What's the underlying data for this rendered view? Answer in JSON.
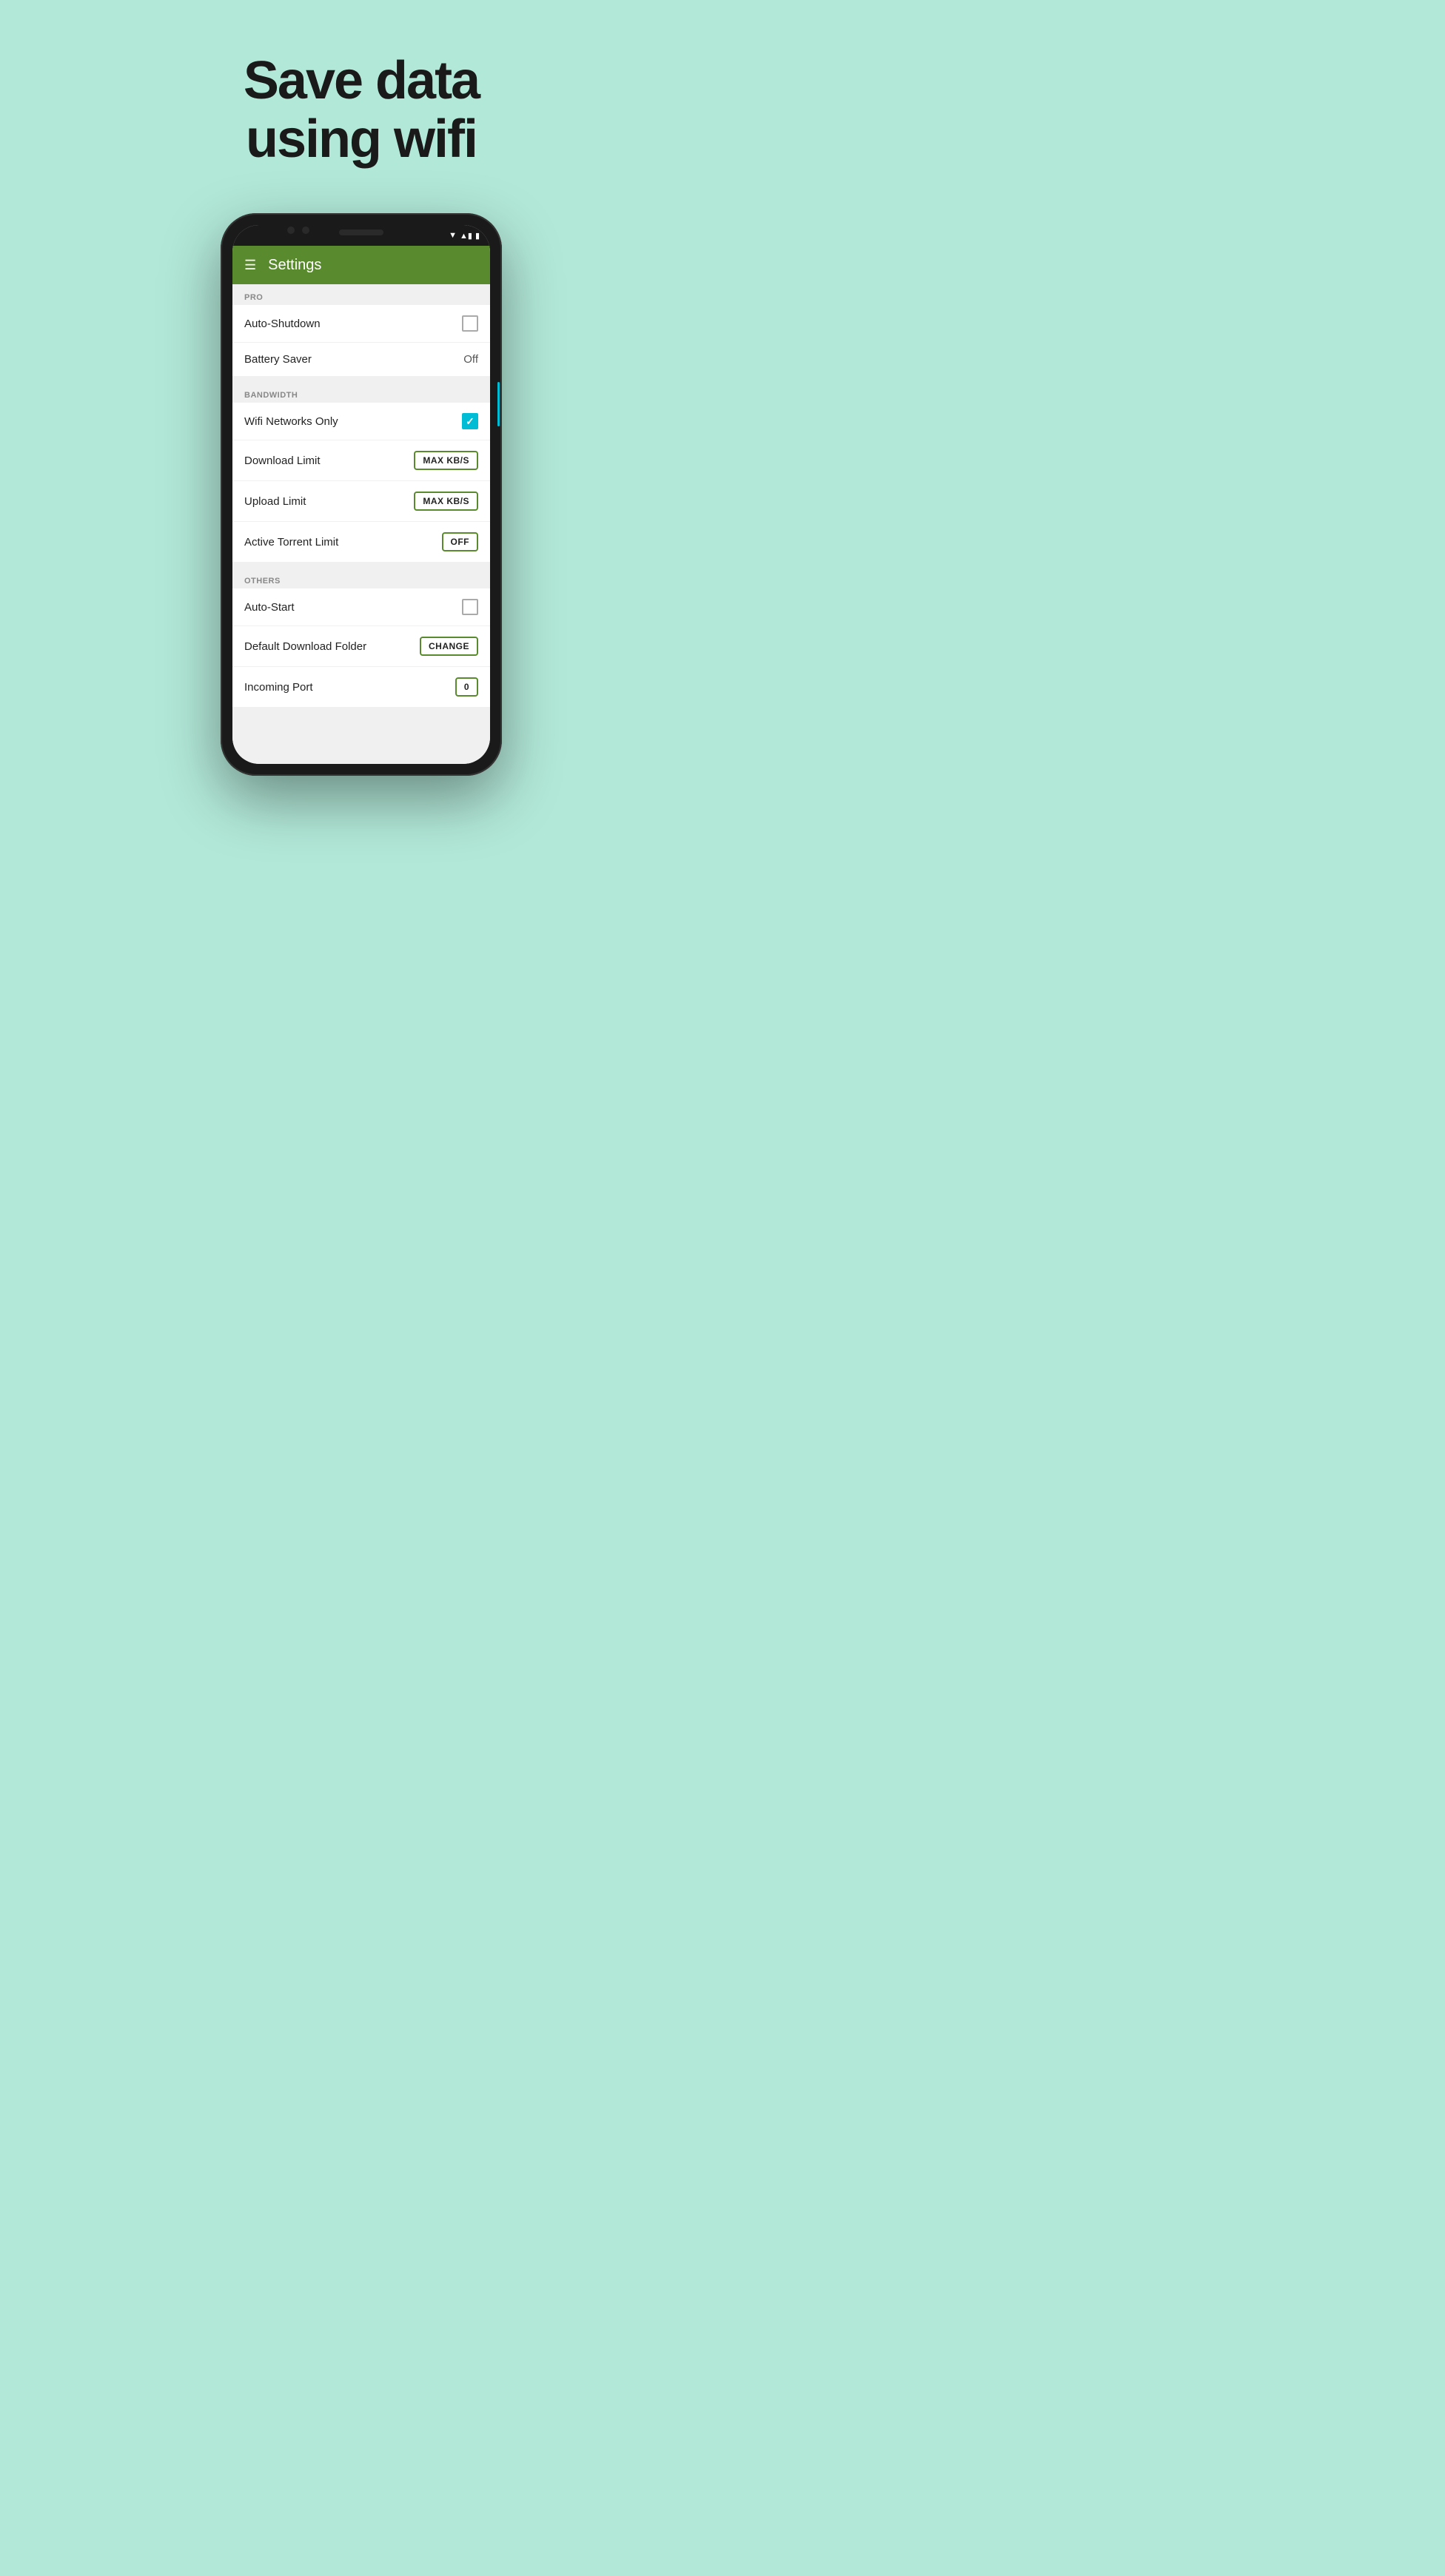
{
  "background_color": "#b2e8d8",
  "hero": {
    "line1": "Save data",
    "line2": "using wifi"
  },
  "phone": {
    "status_bar": {
      "wifi": "▼",
      "signal": "▲",
      "battery": "▮"
    },
    "toolbar": {
      "title": "Settings",
      "menu_icon": "☰"
    },
    "sections": [
      {
        "id": "pro",
        "header": "PRO",
        "items": [
          {
            "label": "Auto-Shutdown",
            "control_type": "checkbox",
            "checked": false
          },
          {
            "label": "Battery Saver",
            "control_type": "value",
            "value": "Off"
          }
        ]
      },
      {
        "id": "bandwidth",
        "header": "BANDWIDTH",
        "items": [
          {
            "label": "Wifi Networks Only",
            "control_type": "checkbox",
            "checked": true
          },
          {
            "label": "Download Limit",
            "control_type": "button",
            "button_label": "MAX KB/S"
          },
          {
            "label": "Upload Limit",
            "control_type": "button",
            "button_label": "MAX KB/S"
          },
          {
            "label": "Active Torrent Limit",
            "control_type": "button",
            "button_label": "OFF"
          }
        ]
      },
      {
        "id": "others",
        "header": "OTHERS",
        "items": [
          {
            "label": "Auto-Start",
            "control_type": "checkbox",
            "checked": false
          },
          {
            "label": "Default Download Folder",
            "control_type": "button",
            "button_label": "CHANGE"
          },
          {
            "label": "Incoming Port",
            "control_type": "button",
            "button_label": "0"
          }
        ]
      }
    ]
  }
}
